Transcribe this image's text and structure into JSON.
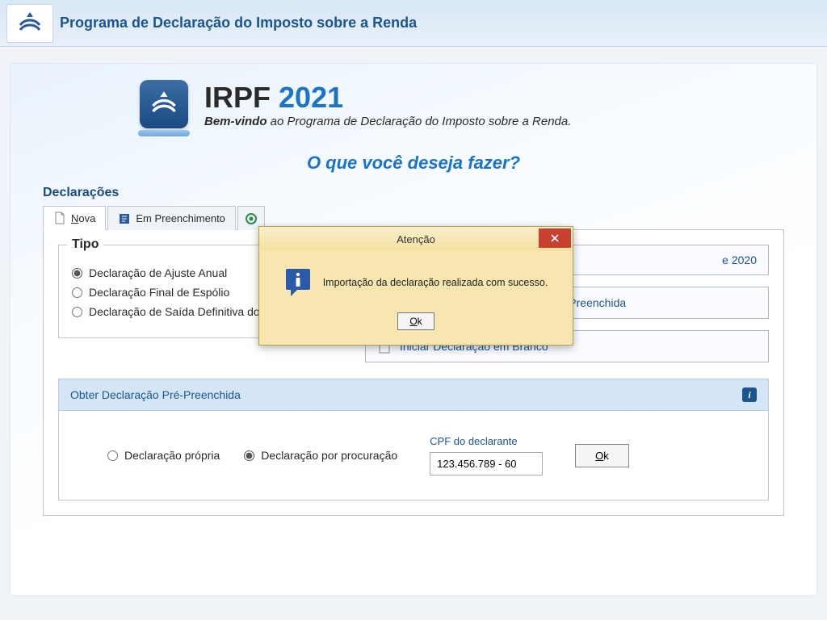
{
  "header": {
    "title": "Programa de Declaração do Imposto sobre a Renda"
  },
  "product": {
    "name": "IRPF",
    "year": "2021",
    "welcome_bold": "Bem-vindo",
    "welcome_rest": " ao Programa de Declaração do Imposto sobre a Renda."
  },
  "prompt": "O que você deseja fazer?",
  "section_label": "Declarações",
  "tabs": {
    "nova_prefix": "N",
    "nova_rest": "ova",
    "em_preenchimento": "Em Preenchimento"
  },
  "tipo": {
    "legend": "Tipo",
    "opt1": "Declaração de Ajuste Anual",
    "opt2": "Declaração Final de Espólio",
    "opt3": "Declaração de Saída Definitiva do País"
  },
  "actions": {
    "a1_suffix": "e 2020",
    "a2": "Iniciar Declaração a partir da Pré-Preenchida",
    "a3": "Iniciar Declaração em Branco"
  },
  "pre": {
    "title": "Obter Declaração Pré-Preenchida",
    "opt1": "Declaração própria",
    "opt2": "Declaração por procuração",
    "cpf_label": "CPF do declarante",
    "cpf_value": "123.456.789 - 60",
    "ok_u": "O",
    "ok_rest": "k"
  },
  "modal": {
    "title": "Atenção",
    "message": "Importação da declaração realizada com sucesso.",
    "ok_u": "O",
    "ok_rest": "k"
  }
}
